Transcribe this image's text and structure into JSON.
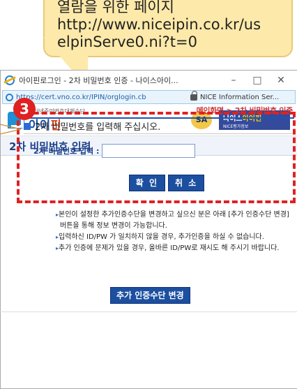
{
  "callout": {
    "text": "열람을 위한 페이지\nhttp://www.niceipin.co.kr/uselpinServe0.ni?t=0",
    "line1": "열람을 위한 페이지",
    "line2": "http://www.niceipin.co.kr/us",
    "line3": "elpinServe0.ni?t=0"
  },
  "window": {
    "title": "아이핀로그인 - 2차 비밀번호 인증 - 나이스아이...",
    "minimize": "–",
    "maximize": "□",
    "close": "✕"
  },
  "address_bar": {
    "url": "https://cert.vno.co.kr/IPIN/orglogin.cb",
    "site_name": "NICE Information Ser..."
  },
  "header": {
    "logo_small": "인터넷주민번호대체수단",
    "logo_big_a": "아이",
    "logo_big_b": "핀",
    "seal": "SA",
    "nice_a": "나이스",
    "nice_b": "아이핀",
    "nice_sub": "NICE평가정보"
  },
  "page": {
    "title": "2차 비밀번호 입력",
    "breadcrumb": "메인화면 > 2차 비밀번호 인증"
  },
  "form": {
    "instruction": "2차 비밀번호를 입력해 주십시오.",
    "pw_label": "2차 비밀번호 입력 :",
    "pw_value": "",
    "confirm": "확 인",
    "cancel": "취 소"
  },
  "annotation": {
    "step": "3"
  },
  "notes": [
    "본인이 설정한 추가인증수단을 변경하고 싶으신 분은 아래 [추가 인증수단 변경] 버튼을 통해 정보 변경이 가능합니다.",
    "입력하신 ID/PW 가 일치하지 않을 경우, 추가인증을 하실 수 없습니다.",
    "추가 인증에 문제가 있을 경우, 올바른 ID/PW로 재시도 해 주시기 바랍니다."
  ],
  "change_button": "추가 인증수단 변경",
  "colors": {
    "accent": "#1c4f9f",
    "highlight": "#e02121",
    "callout": "#fde9a9"
  }
}
